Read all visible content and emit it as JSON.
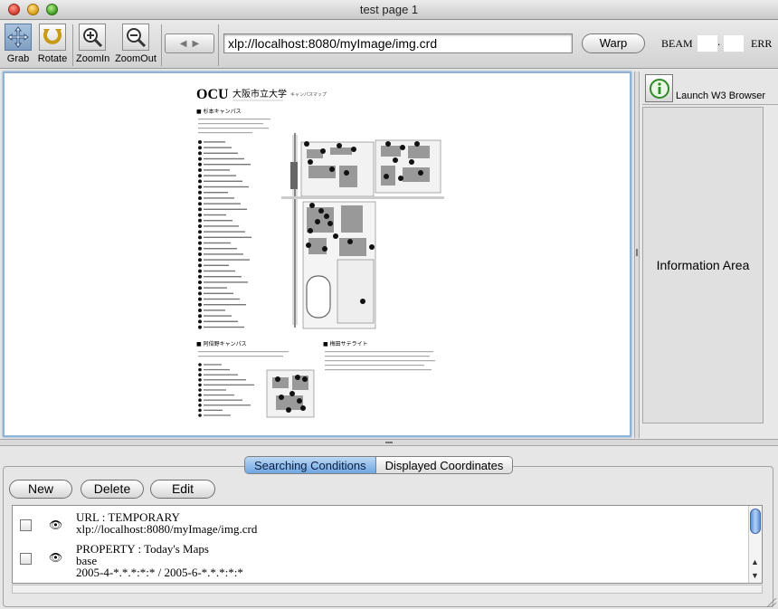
{
  "window": {
    "title": "test page 1"
  },
  "toolbar": {
    "tools": [
      {
        "label": "Grab",
        "icon": "grab-arrows-icon"
      },
      {
        "label": "Rotate",
        "icon": "rotate-icon"
      },
      {
        "label": "ZoomIn",
        "icon": "zoom-in-icon"
      },
      {
        "label": "ZoomOut",
        "icon": "zoom-out-icon"
      }
    ],
    "url": "xlp://localhost:8080/myImage/img.crd",
    "warp_label": "Warp",
    "beam_label": "BEAM",
    "beam_separator": ".",
    "err_label": "ERR"
  },
  "map": {
    "logo": "OCU",
    "university": "大阪市立大学",
    "subtitle": "キャンパスマップ",
    "section_main": "■ 杉本キャンパス",
    "section_abeno": "■ 阿倍野キャンパス",
    "section_satellite": "■ 梅田サテライト"
  },
  "side": {
    "launch_label": "Launch W3 Browser",
    "info_area_label": "Information Area"
  },
  "tabs": [
    {
      "label": "Searching Conditions",
      "selected": true
    },
    {
      "label": "Displayed Coordinates",
      "selected": false
    }
  ],
  "actions": {
    "new_label": "New",
    "delete_label": "Delete",
    "edit_label": "Edit"
  },
  "conditions": [
    {
      "lines": [
        "URL : TEMPORARY",
        "xlp://localhost:8080/myImage/img.crd"
      ]
    },
    {
      "lines": [
        "PROPERTY : Today's Maps",
        "base",
        "2005-4-*.*.*:*:* / 2005-6-*.*.*:*:*"
      ]
    }
  ],
  "icons": {
    "eye": "eye-icon",
    "info": "info-icon"
  }
}
